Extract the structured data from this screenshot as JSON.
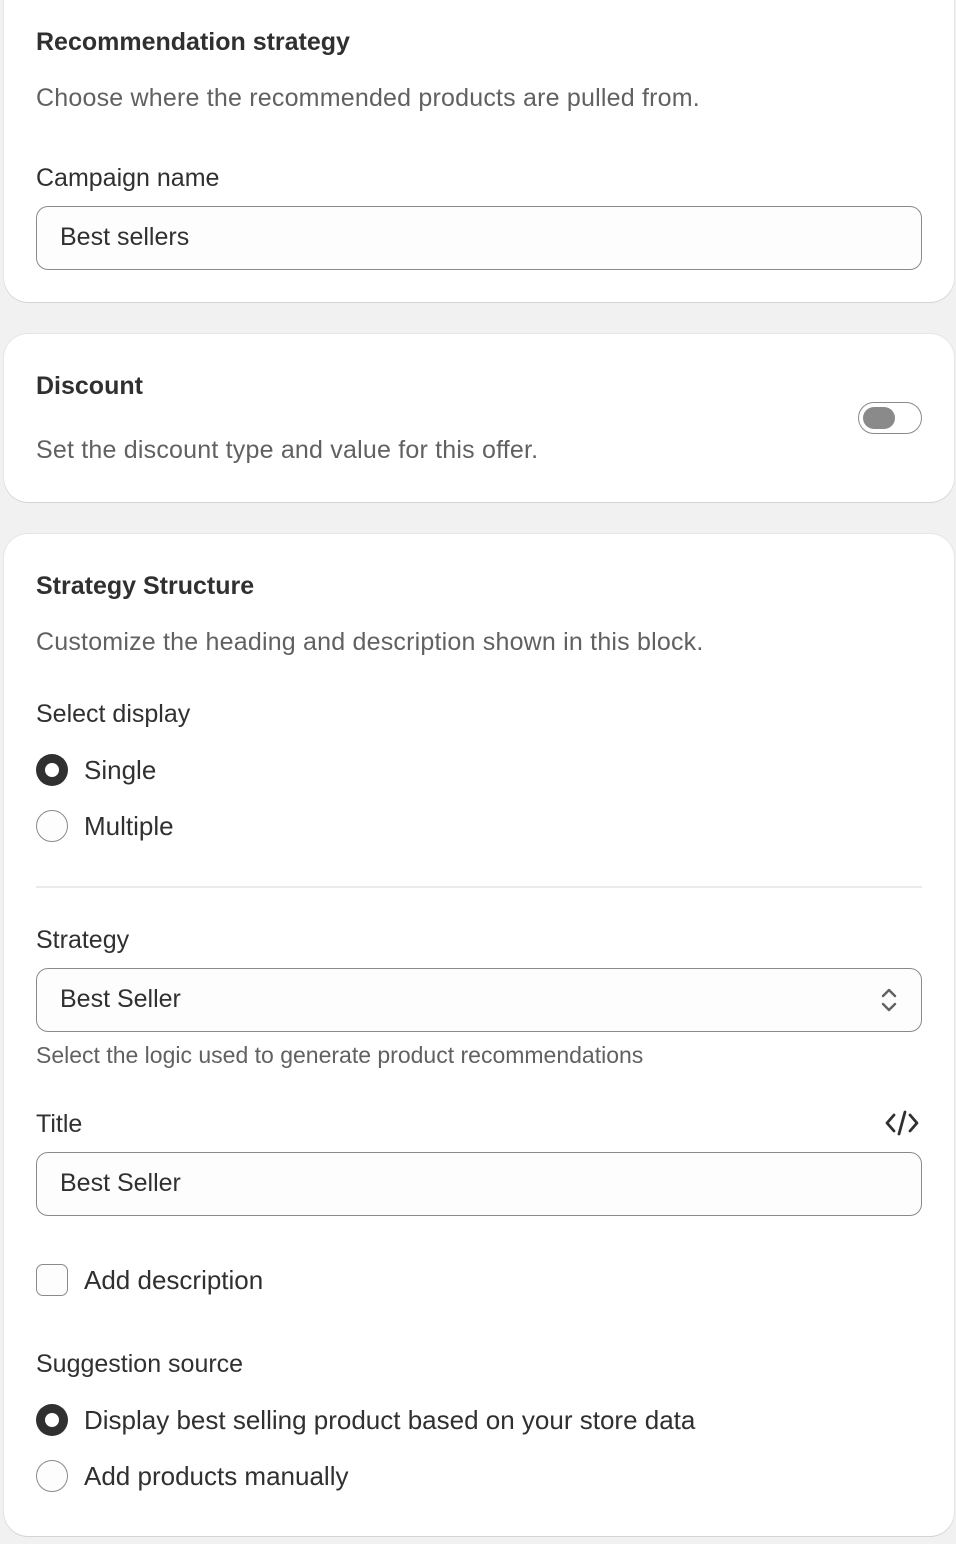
{
  "recommendation": {
    "heading": "Recommendation strategy",
    "description": "Choose where the recommended products are pulled from.",
    "campaign_label": "Campaign name",
    "campaign_value": "Best sellers"
  },
  "discount": {
    "heading": "Discount",
    "description": "Set the discount type and value for this offer.",
    "toggle_on": false
  },
  "structure": {
    "heading": "Strategy Structure",
    "description": "Customize the heading and description shown in this block.",
    "display_label": "Select display",
    "display_options": [
      {
        "label": "Single",
        "selected": true
      },
      {
        "label": "Multiple",
        "selected": false
      }
    ],
    "strategy_label": "Strategy",
    "strategy_value": "Best Seller",
    "strategy_help": "Select the logic used to generate product recommendations",
    "title_label": "Title",
    "title_value": "Best Seller",
    "add_description_label": "Add description",
    "add_description_checked": false,
    "source_label": "Suggestion source",
    "source_options": [
      {
        "label": "Display best selling product based on your store data",
        "selected": true
      },
      {
        "label": "Add products manually",
        "selected": false
      }
    ]
  },
  "icons": {
    "select_chevron": "select-chevron-icon",
    "code": "code-icon"
  }
}
